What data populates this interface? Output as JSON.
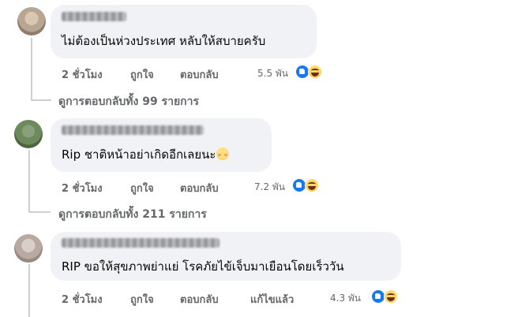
{
  "comments": [
    {
      "text": "ไม่ต้องเป็นห่วงประเทศ หลับให้สบายครับ",
      "time": "2 ชั่วโมง",
      "like": "ถูกใจ",
      "reply": "ตอบกลับ",
      "reaction_count": "5.5 พัน",
      "reactions": [
        "like-icon",
        "haha-icon"
      ],
      "view_replies": "ดูการตอบกลับทั้ง 99 รายการ"
    },
    {
      "text": "Rip ชาติหน้าอย่าเกิดอีกเลยนะ",
      "text_emoji": "face-with-hand-icon",
      "time": "2 ชั่วโมง",
      "like": "ถูกใจ",
      "reply": "ตอบกลับ",
      "reaction_count": "7.2 พัน",
      "reactions": [
        "like-icon",
        "haha-icon"
      ],
      "view_replies": "ดูการตอบกลับทั้ง 211 รายการ"
    },
    {
      "text": "RIP ขอให้สุขภาพย่าแย่ โรคภัยไข้เจ็บมาเยือนโดยเร็ววัน",
      "time": "2 ชั่วโมง",
      "like": "ถูกใจ",
      "reply": "ตอบกลับ",
      "edited": "แก้ไขแล้ว",
      "reaction_count": "4.3 พัน",
      "reactions": [
        "like-icon",
        "haha-icon"
      ]
    }
  ],
  "colors": {
    "bubble": "#f0f2f5",
    "meta_text": "#65676b",
    "like_blue": "#1877f2",
    "thread_line": "#ccd0d5"
  }
}
